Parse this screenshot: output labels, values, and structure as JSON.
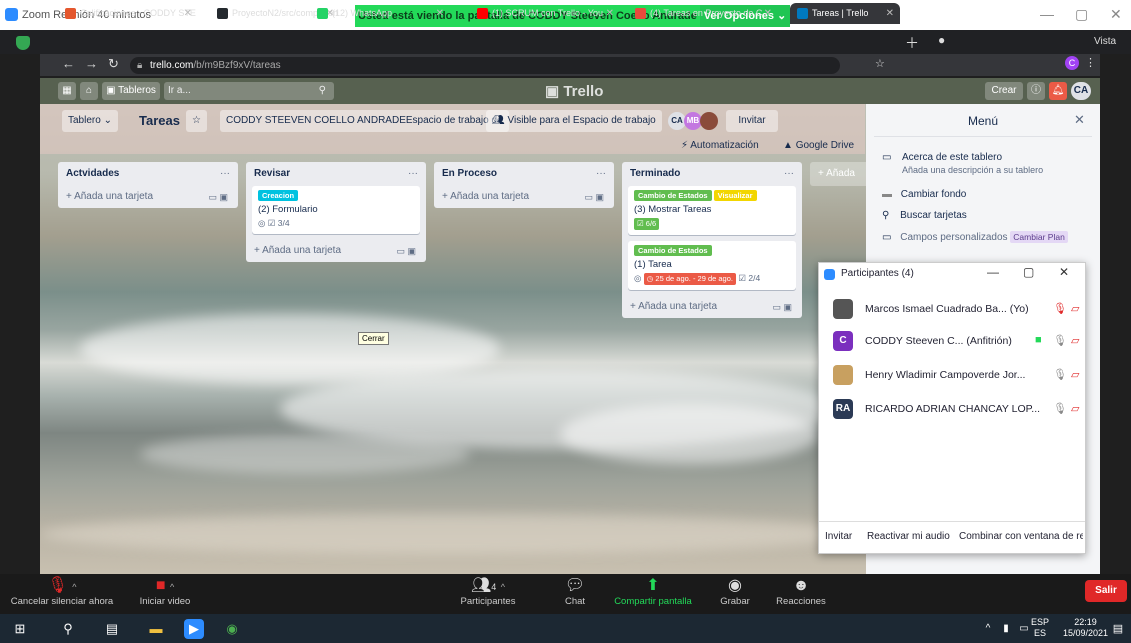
{
  "zoom": {
    "window_title": "Zoom Reunión 40 minutos",
    "share_banner": "Usted está viendo la pantalla de CODDY  Steeven Coello Andrade",
    "view_options": "Ver Opciones ⌄"
  },
  "browser": {
    "tabs": [
      {
        "label": "Calificaciones - CODDY STE",
        "color": "#e4572e",
        "active": false
      },
      {
        "label": "ProyectoN2/src/componen",
        "color": "#24292e",
        "active": false
      },
      {
        "label": "(12) WhatsApp",
        "color": "#25d366",
        "active": false
      },
      {
        "label": "(1) SCRUM con Trello - You",
        "color": "#ff0000",
        "active": false
      },
      {
        "label": "(4) Tareas en Proyecto de C",
        "color": "#e74c3c",
        "active": false
      },
      {
        "label": "Tareas | Trello",
        "color": "#0079bf",
        "active": true
      }
    ],
    "url_domain": "trello.com",
    "url_path": "/b/m9Bzf9xV/tareas",
    "vista_label": "Vista",
    "profile_initial": "C"
  },
  "trello_header": {
    "tableros": "Tableros",
    "search_placeholder": "Ir a...",
    "logo": "Trello",
    "crear": "Crear",
    "avatar": "CA"
  },
  "board": {
    "view_button": "Tablero ⌄",
    "title": "Tareas",
    "workspace": "CODDY STEEVEN COELLO ANDRADEEspacio de trabajo de",
    "visibility": "Visible para el Espacio de trabajo",
    "member_initials": [
      "CA",
      "MB"
    ],
    "invite": "Invitar",
    "automation": "Automatización",
    "google_drive": "Google Drive"
  },
  "lists": [
    {
      "title": "Actvidades",
      "cards": [],
      "add": "+ Añada una tarjeta"
    },
    {
      "title": "Revisar",
      "cards": [
        {
          "labels": [
            {
              "text": "Creacion",
              "color": "#00c2e0"
            }
          ],
          "title": "(2) Formulario",
          "badges": "◎   ☑ 3/4"
        }
      ],
      "add": "+ Añada una tarjeta"
    },
    {
      "title": "En Proceso",
      "cards": [],
      "add": "+ Añada una tarjeta"
    },
    {
      "title": "Terminado",
      "cards": [
        {
          "labels": [
            {
              "text": "Cambio de Estados",
              "color": "#61bd4f"
            },
            {
              "text": "Visualizar",
              "color": "#f2d600"
            }
          ],
          "title": "(3) Mostrar Tareas",
          "check": "☑ 6/6"
        },
        {
          "labels": [
            {
              "text": "Cambio de Estados",
              "color": "#61bd4f"
            }
          ],
          "title": "(1) Tarea",
          "due": "◷ 25 de ago. - 29 de ago.",
          "check2": "☑ 2/4"
        }
      ],
      "add": "+ Añada una tarjeta"
    }
  ],
  "add_list": "+ Añada",
  "tooltip": "Cerrar",
  "menu": {
    "title": "Menú",
    "about_title": "Acerca de este tablero",
    "about_sub": "Añada una descripción a su tablero",
    "change_bg": "Cambiar fondo",
    "search_cards": "Buscar tarjetas",
    "custom_fields": "Campos personalizados",
    "change_plan": "Cambiar Plan"
  },
  "participants": {
    "title": "Participantes (4)",
    "people": [
      {
        "name": "Marcos Ismael Cuadrado Ba... (Yo)",
        "avatar": "",
        "color": "#555"
      },
      {
        "name": "CODDY  Steeven C... (Anfitrión)",
        "avatar": "C",
        "color": "#7b2fbe"
      },
      {
        "name": "Henry Wladimir Campoverde Jor...",
        "avatar": "",
        "color": "#c8a060"
      },
      {
        "name": "RICARDO ADRIAN CHANCAY LOP...",
        "avatar": "RA",
        "color": "#2b3a55"
      }
    ],
    "footer": [
      "Invitar",
      "Reactivar mi audio",
      "Combinar con ventana de re"
    ]
  },
  "zoom_controls": {
    "unmute": "Cancelar silenciar ahora",
    "video": "Iniciar video",
    "participants": "Participantes",
    "participants_count": "4",
    "chat": "Chat",
    "share": "Compartir pantalla",
    "record": "Grabar",
    "reactions": "Reacciones",
    "leave": "Salir"
  },
  "taskbar": {
    "lang1": "ESP",
    "lang2": "ES",
    "time": "22:19",
    "date": "15/09/2021"
  }
}
